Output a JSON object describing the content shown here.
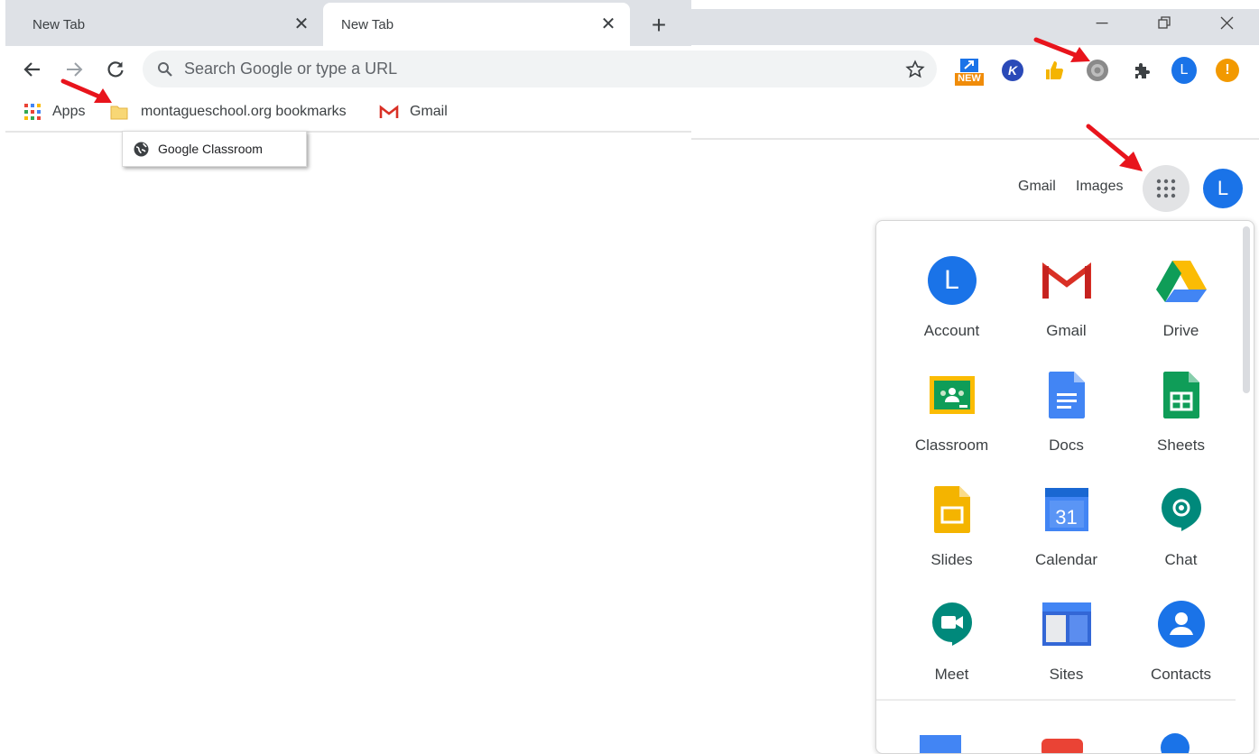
{
  "left_browser": {
    "tabs": [
      {
        "label": "New Tab"
      },
      {
        "label": "New Tab"
      }
    ],
    "omnibox": {
      "placeholder": "Search Google or type a URL"
    },
    "bookmarks": {
      "apps": "Apps",
      "folder": "montagueschool.org bookmarks",
      "gmail": "Gmail"
    },
    "dropdown": {
      "item": "Google Classroom"
    }
  },
  "right_browser": {
    "extensions": {
      "new_badge": "NEW",
      "k_letter": "K",
      "profile_letter": "L",
      "alert_mark": "!"
    },
    "header": {
      "gmail": "Gmail",
      "images": "Images",
      "avatar_letter": "L"
    },
    "apps_panel": {
      "account_letter": "L",
      "calendar_day": "31",
      "apps": [
        {
          "label": "Account"
        },
        {
          "label": "Gmail"
        },
        {
          "label": "Drive"
        },
        {
          "label": "Classroom"
        },
        {
          "label": "Docs"
        },
        {
          "label": "Sheets"
        },
        {
          "label": "Slides"
        },
        {
          "label": "Calendar"
        },
        {
          "label": "Chat"
        },
        {
          "label": "Meet"
        },
        {
          "label": "Sites"
        },
        {
          "label": "Contacts"
        }
      ]
    }
  },
  "colors": {
    "accent_blue": "#1a73e8",
    "tab_strip": "#dee1e6",
    "annotation_red": "#e8141c",
    "omnibox_bg": "#f1f3f4"
  }
}
